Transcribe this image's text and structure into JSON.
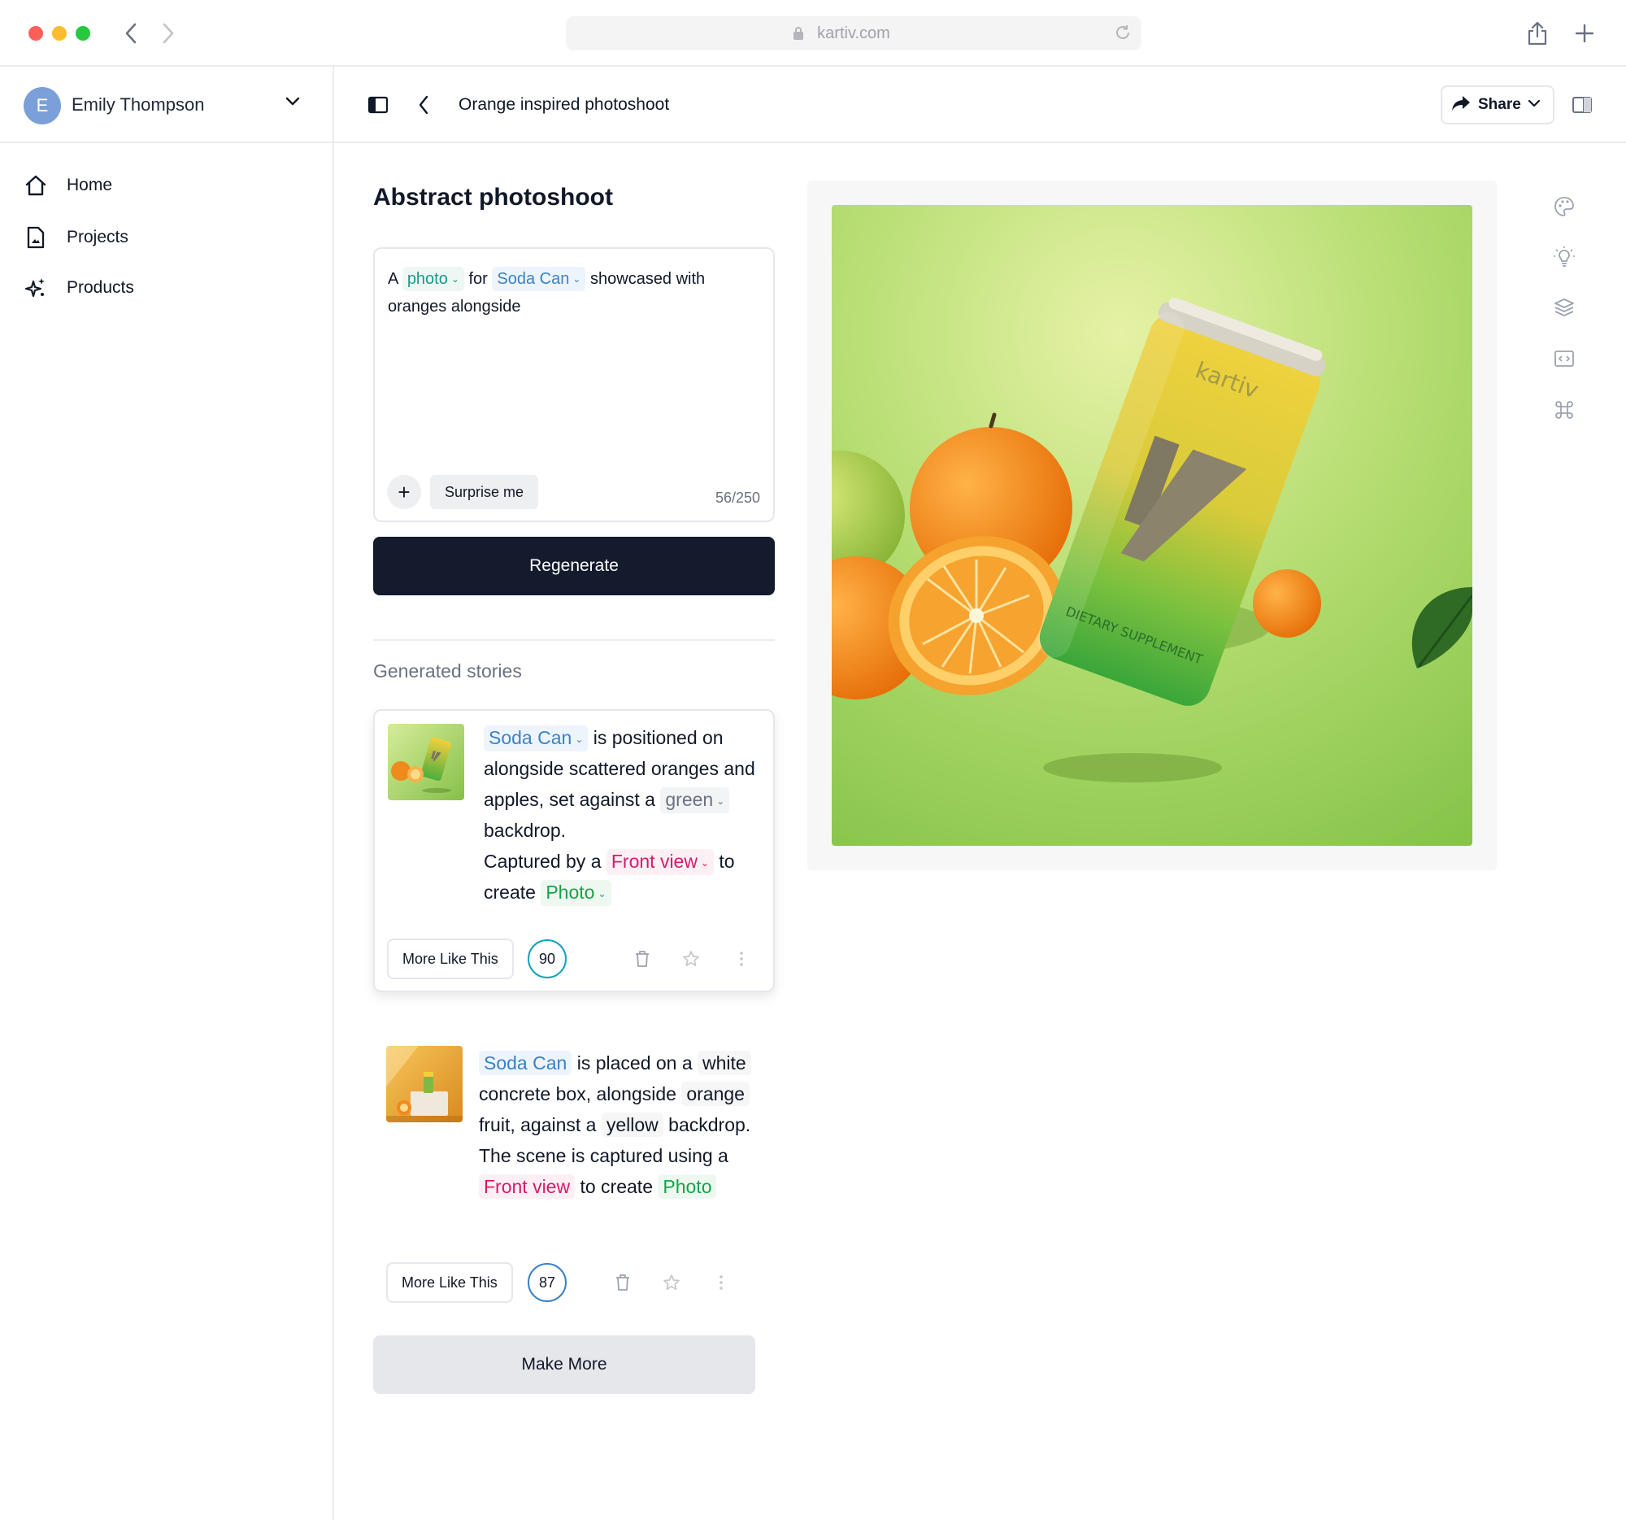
{
  "browser": {
    "url": "kartiv.com"
  },
  "sidebar": {
    "user": {
      "initial": "E",
      "name": "Emily Thompson"
    },
    "items": [
      {
        "label": "Home",
        "icon": "home-icon"
      },
      {
        "label": "Projects",
        "icon": "document-icon"
      },
      {
        "label": "Products",
        "icon": "sparkles-icon"
      }
    ]
  },
  "header": {
    "title": "Orange inspired photoshoot",
    "share_label": "Share"
  },
  "editor": {
    "heading": "Abstract photoshoot",
    "prompt": {
      "w1": "A",
      "chip_type": "photo",
      "w2": "for",
      "chip_product": "Soda Can",
      "w3": "showcased with oranges alongside"
    },
    "surprise_label": "Surprise me",
    "counter": "56/250",
    "regenerate_label": "Regenerate"
  },
  "stories": {
    "heading": "Generated stories",
    "items": [
      {
        "product": "Soda Can",
        "t1": "is positioned on alongside scattered oranges and apples, set against a",
        "color": "green",
        "t2": "backdrop.",
        "t3": "Captured by a",
        "view": "Front view",
        "t4": "to create",
        "style": "Photo",
        "more_label": "More Like This",
        "score": "90"
      },
      {
        "product": "Soda Can",
        "t1": "is placed on a",
        "material_color": "white",
        "t2": "concrete box, alongside",
        "fruit": "orange",
        "t3": "fruit, against a",
        "backdrop": "yellow",
        "t4": "backdrop.",
        "t5": "The scene is captured using a",
        "view": "Front view",
        "t6": "to create",
        "style": "Photo",
        "more_label": "More Like This",
        "score": "87"
      }
    ],
    "make_more_label": "Make More"
  },
  "preview": {
    "brand_text": "kartiv",
    "can_text": "DIETARY SUPPLEMENT"
  },
  "colors": {
    "accent_dark": "#141b2d",
    "chip_blue": "#3b82c4",
    "chip_pink": "#d61b6b",
    "chip_green": "#16a34a",
    "score_ring_1": "#14a3b8",
    "score_ring_2": "#3b82c4"
  }
}
